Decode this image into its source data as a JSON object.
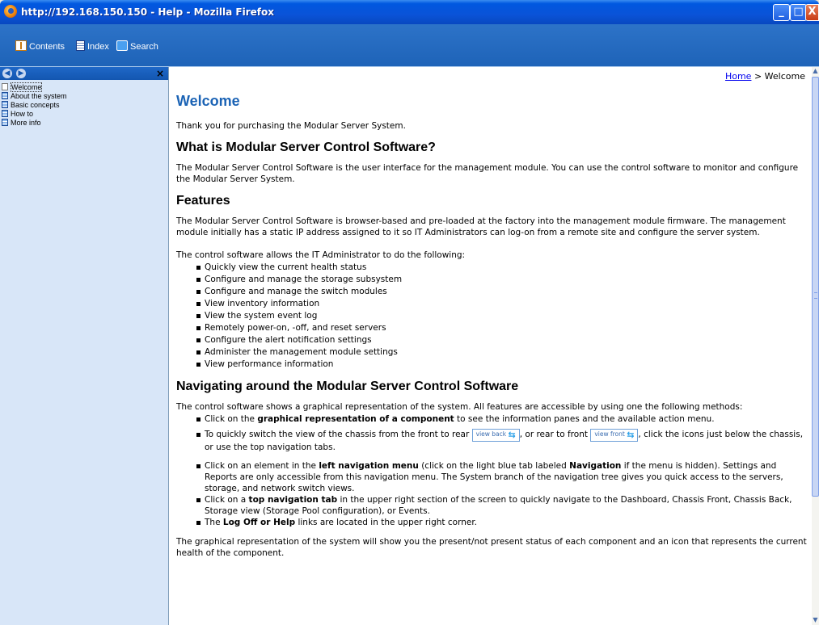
{
  "window": {
    "title": "http://192.168.150.150 - Help - Mozilla Firefox",
    "min_glyph": "_",
    "max_glyph": "□",
    "close_glyph": "X"
  },
  "toolbar": {
    "contents_label": "Contents",
    "index_label": "Index",
    "search_label": "Search"
  },
  "nav": {
    "back_glyph": "◀",
    "forward_glyph": "▶",
    "close_glyph": "×",
    "items": [
      {
        "label": "Welcome"
      },
      {
        "label": "About the system"
      },
      {
        "label": "Basic concepts"
      },
      {
        "label": "How to"
      },
      {
        "label": "More info"
      }
    ]
  },
  "breadcrumb": {
    "home": "Home",
    "separator": " > ",
    "current": "Welcome"
  },
  "content": {
    "title": "Welcome",
    "intro": "Thank you for purchasing the Modular Server System.",
    "what_heading": "What is Modular Server Control Software?",
    "what_text": "The Modular Server Control Software is the user interface for the management module. You can use the control software to monitor and configure the Modular Server System.",
    "features_heading": "Features",
    "features_text": "The Modular Server Control Software is browser-based and pre-loaded at the factory into the management module firmware. The management module initially has a static IP address assigned to it so IT Administrators can log-on from a remote site and configure the server system.",
    "allows_text": "The control software allows the IT Administrator to do the following:",
    "features_list": [
      "Quickly view the current health status",
      "Configure and manage the storage subsystem",
      "Configure and manage the switch modules",
      "View inventory information",
      "View the system event log",
      "Remotely power-on, -off, and reset servers",
      "Configure the alert notification settings",
      "Administer the management module settings",
      "View performance information"
    ],
    "nav_heading": "Navigating around the Modular Server Control Software",
    "nav_intro": "The control software shows a graphical representation of the system.  All features are accessible by using one the following methods:",
    "nav_item1": {
      "pre": "Click on the ",
      "bold": "graphical representation of a component",
      "post": " to see the information panes and the available action menu."
    },
    "nav_item2": {
      "pre": "To quickly switch the view of the chassis from the front to rear ",
      "view_back": "view back",
      "mid": ", or rear to front ",
      "view_front": "view front",
      "post": ", click the icons just below the chassis, or use the top navigation tabs."
    },
    "nav_item3": {
      "pre": "Click on an element in the ",
      "bold1": "left navigation menu",
      "mid": " (click on the light blue tab labeled ",
      "bold2": "Navigation",
      "post": " if the menu is hidden).  Settings and Reports are only accessible from this navigation menu. The System branch of the navigation tree gives you quick access to the servers, storage, and network switch views."
    },
    "nav_item4": {
      "pre": "Click on a ",
      "bold": "top navigation tab",
      "post": " in the upper right section of the screen to quickly navigate to the Dashboard, Chassis Front, Chassis Back, Storage view (Storage Pool configuration), or Events."
    },
    "nav_item5": {
      "pre": "The ",
      "bold": "Log Off or Help",
      "post": " links are located in the upper right corner."
    },
    "closing": "The graphical representation of the system will show you the present/not present status of each component and an icon that represents the current health of the component."
  },
  "colors": {
    "titlebar": "#0a53d8",
    "toolbar": "#2d73c8",
    "heading_blue": "#1b63b5",
    "nav_pane": "#d8e6f8"
  },
  "icons": [
    "firefox-icon",
    "book-icon",
    "index-icon",
    "search-icon",
    "back-icon",
    "forward-icon",
    "page-icon",
    "swap-arrows-icon"
  ]
}
